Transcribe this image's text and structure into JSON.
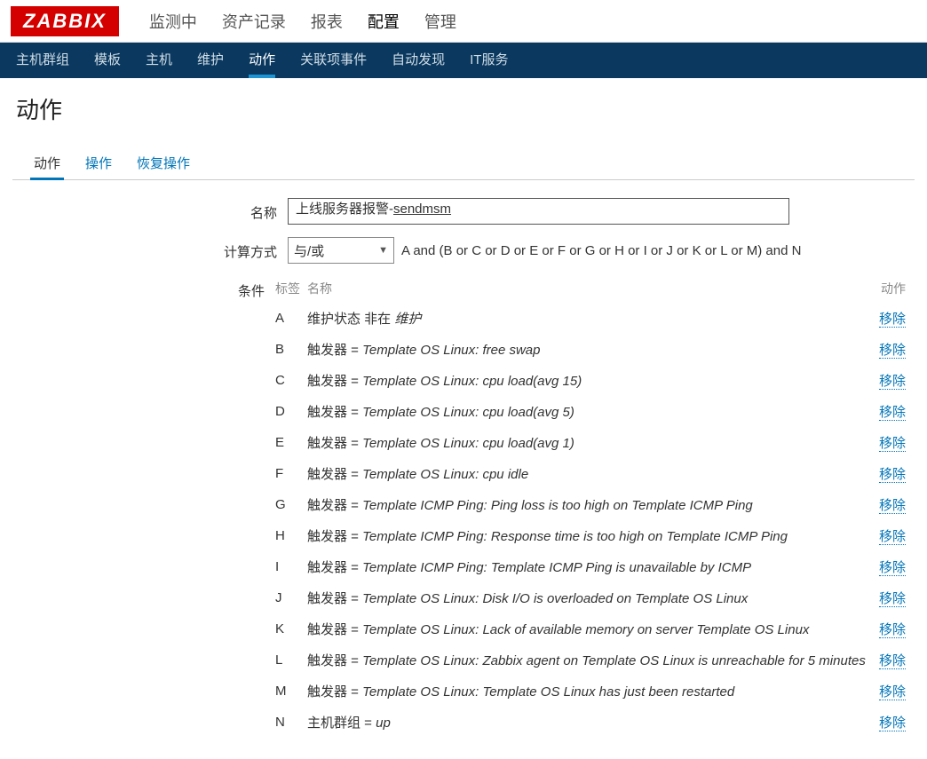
{
  "logo": "ZABBIX",
  "topnav": [
    "监测中",
    "资产记录",
    "报表",
    "配置",
    "管理"
  ],
  "topnav_active": 3,
  "subnav": [
    "主机群组",
    "模板",
    "主机",
    "维护",
    "动作",
    "关联项事件",
    "自动发现",
    "IT服务"
  ],
  "subnav_active": 4,
  "page_title": "动作",
  "tabs": [
    "动作",
    "操作",
    "恢复操作"
  ],
  "tabs_active": 0,
  "form": {
    "name_label": "名称",
    "name_prefix": "上线服务器报警-",
    "name_suffix": "sendmsm",
    "calc_label": "计算方式",
    "calc_select": "与/或",
    "calc_expr": "A and (B or C or D or E or F or G or H or I or J or K or L or M) and N",
    "cond_label": "条件",
    "cond_header_tag": "标签",
    "cond_header_name": "名称",
    "cond_header_act": "动作",
    "remove_label": "移除",
    "conditions": [
      {
        "tag": "A",
        "pre": "维护状态 非在 ",
        "ital": "维护"
      },
      {
        "tag": "B",
        "pre": "触发器 = ",
        "ital": "Template OS Linux: free swap"
      },
      {
        "tag": "C",
        "pre": "触发器 = ",
        "ital": "Template OS Linux: cpu load(avg 15)"
      },
      {
        "tag": "D",
        "pre": "触发器 = ",
        "ital": "Template OS Linux: cpu load(avg 5)"
      },
      {
        "tag": "E",
        "pre": "触发器 = ",
        "ital": "Template OS Linux: cpu load(avg 1)"
      },
      {
        "tag": "F",
        "pre": "触发器 = ",
        "ital": "Template OS Linux: cpu idle"
      },
      {
        "tag": "G",
        "pre": "触发器 = ",
        "ital": "Template ICMP Ping: Ping loss is too high on Template ICMP Ping"
      },
      {
        "tag": "H",
        "pre": "触发器 = ",
        "ital": "Template ICMP Ping: Response time is too high on Template ICMP Ping"
      },
      {
        "tag": "I",
        "pre": "触发器 = ",
        "ital": "Template ICMP Ping: Template ICMP Ping is unavailable by ICMP"
      },
      {
        "tag": "J",
        "pre": "触发器 = ",
        "ital": "Template OS Linux: Disk I/O is overloaded on Template OS Linux"
      },
      {
        "tag": "K",
        "pre": "触发器 = ",
        "ital": "Template OS Linux: Lack of available memory on server Template OS Linux"
      },
      {
        "tag": "L",
        "pre": "触发器 = ",
        "ital": "Template OS Linux: Zabbix agent on Template OS Linux is unreachable for 5 minutes"
      },
      {
        "tag": "M",
        "pre": "触发器 = ",
        "ital": "Template OS Linux: Template OS Linux has just been restarted"
      },
      {
        "tag": "N",
        "pre": "主机群组 = ",
        "ital": "up"
      }
    ]
  }
}
